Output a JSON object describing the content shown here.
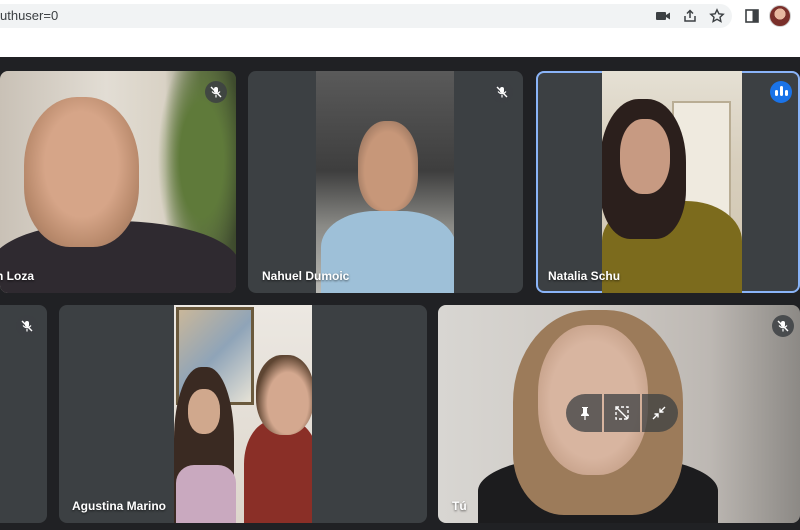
{
  "browser": {
    "url_fragment": "uthuser=0"
  },
  "participants": [
    {
      "name": "n Loza",
      "muted": true
    },
    {
      "name": "Nahuel Dumoic",
      "muted": true
    },
    {
      "name": "Natalia Schu",
      "speaking": true
    },
    {
      "name": "",
      "muted": true
    },
    {
      "name": "Agustina Marino"
    },
    {
      "name": "Tú",
      "muted": true
    }
  ],
  "colors": {
    "meet_bg": "#202124",
    "tile_bg": "#3c4043",
    "accent": "#8ab4f8",
    "speaking": "#1a73e8"
  },
  "icons": [
    "camera-icon",
    "share-icon",
    "star-icon",
    "sidebar-icon",
    "mic-off-icon",
    "pin-icon",
    "remove-frame-icon",
    "minimize-icon"
  ]
}
